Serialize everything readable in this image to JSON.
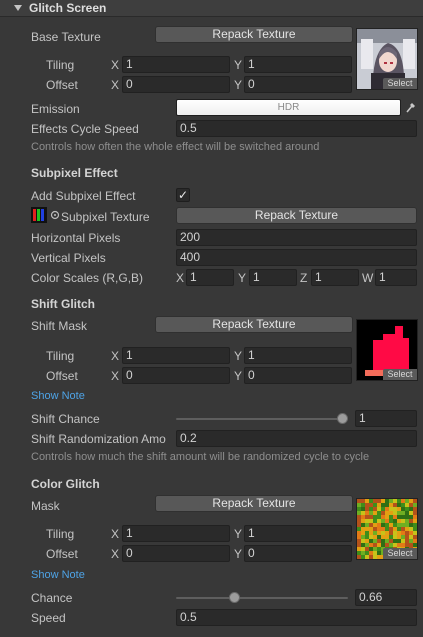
{
  "header": {
    "title": "Glitch Screen"
  },
  "base_texture": {
    "label": "Base Texture",
    "button": "Repack Texture",
    "tiling_label": "Tiling",
    "tiling_x": "1",
    "tiling_y": "1",
    "offset_label": "Offset",
    "offset_x": "0",
    "offset_y": "0",
    "select": "Select"
  },
  "emission": {
    "label": "Emission",
    "value": "HDR"
  },
  "effects_cycle": {
    "label": "Effects Cycle Speed",
    "value": "0.5",
    "hint": "Controls how often the whole effect will be switched around"
  },
  "subpixel": {
    "section": "Subpixel Effect",
    "add_label": "Add Subpixel Effect",
    "add_checked": "✓",
    "texture_label": "Subpixel Texture",
    "texture_button": "Repack Texture",
    "hpixels_label": "Horizontal Pixels",
    "hpixels": "200",
    "vpixels_label": "Vertical Pixels",
    "vpixels": "400",
    "scales_label": "Color Scales (R,G,B)",
    "scale_x": "1",
    "scale_y": "1",
    "scale_z": "1",
    "scale_w": "1"
  },
  "shift": {
    "section": "Shift Glitch",
    "mask_label": "Shift Mask",
    "button": "Repack Texture",
    "tiling_label": "Tiling",
    "tiling_x": "1",
    "tiling_y": "1",
    "offset_label": "Offset",
    "offset_x": "0",
    "offset_y": "0",
    "select": "Select",
    "show_note": "Show Note",
    "chance_label": "Shift Chance",
    "chance": "1",
    "chance_fraction": 1.0,
    "rand_label": "Shift Randomization Amo",
    "rand": "0.2",
    "hint": "Controls how much the shift amount will be randomized cycle to cycle"
  },
  "color": {
    "section": "Color Glitch",
    "mask_label": "Mask",
    "button": "Repack Texture",
    "tiling_label": "Tiling",
    "tiling_x": "1",
    "tiling_y": "1",
    "offset_label": "Offset",
    "offset_x": "0",
    "offset_y": "0",
    "select": "Select",
    "show_note": "Show Note",
    "chance_label": "Chance",
    "chance": "0.66",
    "chance_fraction": 0.33,
    "speed_label": "Speed",
    "speed": "0.5"
  },
  "axes": {
    "x": "X",
    "y": "Y",
    "z": "Z",
    "w": "W"
  },
  "colors": {
    "accent_link": "#4ea3e6",
    "shift_mask_red": "#ff0a45"
  }
}
